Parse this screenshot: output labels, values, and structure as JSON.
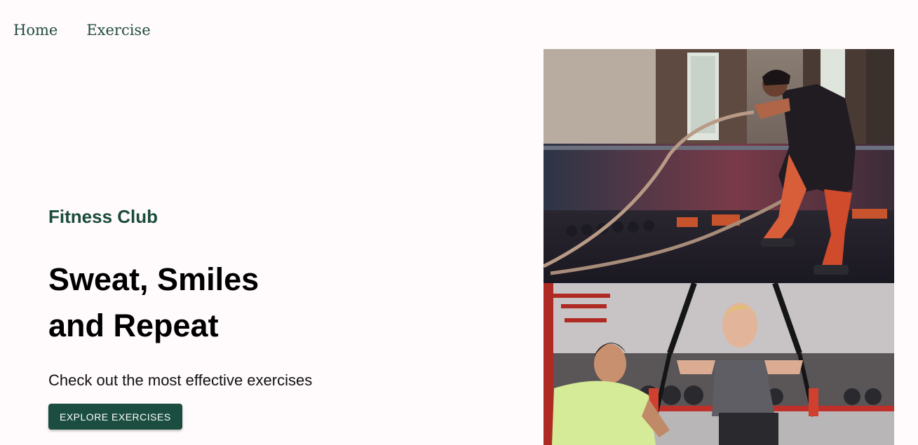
{
  "nav": {
    "items": [
      {
        "label": "Home"
      },
      {
        "label": "Exercise"
      }
    ]
  },
  "hero": {
    "brand": "Fitness Club",
    "headline_line1": "Sweat, Smiles",
    "headline_line2": "and Repeat",
    "subline": "Check out the most effective exercises",
    "cta_label": "EXPLORE EXERCISES"
  },
  "images": {
    "top_icon": "battle-ropes-photo",
    "bottom_icon": "trx-training-photo"
  },
  "colors": {
    "background": "#fffafb",
    "accent": "#1b4e40",
    "nav_text": "#1f4c41"
  }
}
